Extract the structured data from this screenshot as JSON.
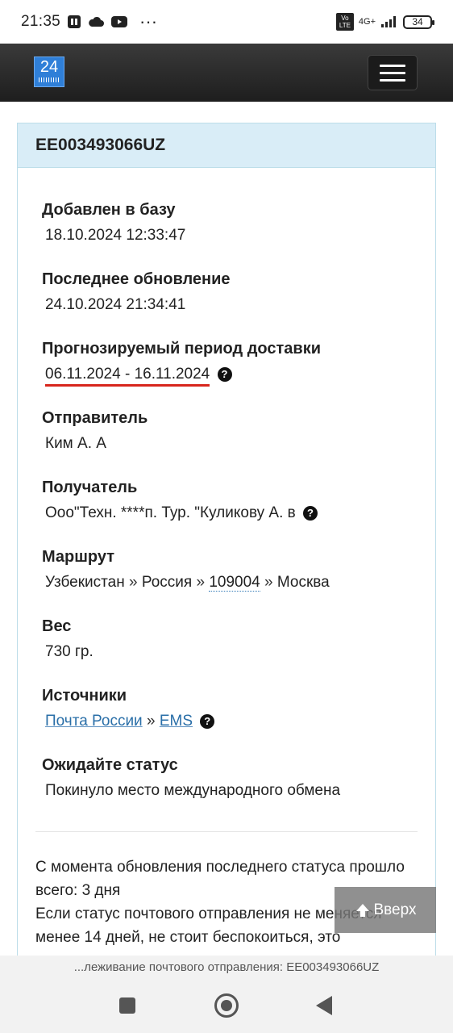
{
  "status_bar": {
    "time": "21:35",
    "dots": "···",
    "network": "4G+",
    "volte": "Vo LTE",
    "battery": "34"
  },
  "navbar": {
    "logo_text": "24"
  },
  "card": {
    "tracking_number": "EE003493066UZ",
    "fields": {
      "added": {
        "label": "Добавлен в базу",
        "value": "18.10.2024 12:33:47"
      },
      "updated": {
        "label": "Последнее обновление",
        "value": "24.10.2024 21:34:41"
      },
      "delivery": {
        "label": "Прогнозируемый период доставки",
        "value": "06.11.2024 - 16.11.2024"
      },
      "sender": {
        "label": "Отправитель",
        "value": "Ким А. А"
      },
      "recipient": {
        "label": "Получатель",
        "value": "Ооо\"Техн. ****п. Тур. \"Куликову А. в"
      },
      "route": {
        "label": "Маршрут",
        "from": "Узбекистан",
        "via": "Россия",
        "index": "109004",
        "to": "Москва"
      },
      "weight": {
        "label": "Вес",
        "value": "730 гр."
      },
      "sources": {
        "label": "Источники",
        "source1": "Почта России",
        "source2": "EMS"
      },
      "expect": {
        "label": "Ожидайте статус",
        "value": "Покинуло место международного обмена"
      }
    },
    "note_line1": "С момента обновления последнего статуса прошло всего: 3 дня",
    "note_line2": "Если статус почтового отправления не меняется менее 14 дней, не стоит беспокоиться, это"
  },
  "up_button": {
    "label": "Вверх"
  },
  "url_bar": {
    "text": "...леживание почтового отправления: EE003493066UZ"
  }
}
